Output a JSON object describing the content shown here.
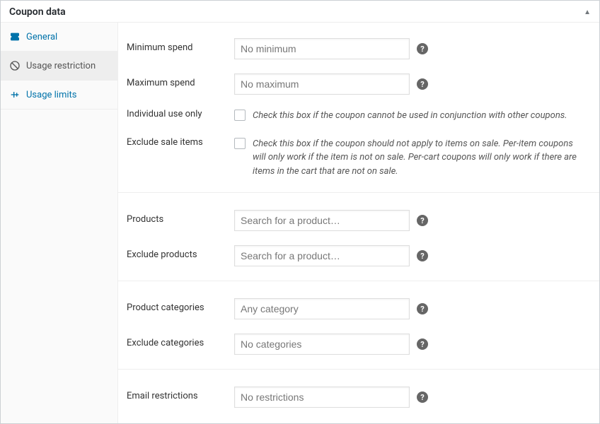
{
  "panel": {
    "title": "Coupon data"
  },
  "tabs": {
    "general": "General",
    "usage_restriction": "Usage restriction",
    "usage_limits": "Usage limits"
  },
  "fields": {
    "min_spend": {
      "label": "Minimum spend",
      "placeholder": "No minimum"
    },
    "max_spend": {
      "label": "Maximum spend",
      "placeholder": "No maximum"
    },
    "individual_use": {
      "label": "Individual use only",
      "desc": "Check this box if the coupon cannot be used in conjunction with other coupons."
    },
    "exclude_sale": {
      "label": "Exclude sale items",
      "desc": "Check this box if the coupon should not apply to items on sale. Per-item coupons will only work if the item is not on sale. Per-cart coupons will only work if there are items in the cart that are not on sale."
    },
    "products": {
      "label": "Products",
      "placeholder": "Search for a product…"
    },
    "exclude_products": {
      "label": "Exclude products",
      "placeholder": "Search for a product…"
    },
    "product_categories": {
      "label": "Product categories",
      "placeholder": "Any category"
    },
    "exclude_categories": {
      "label": "Exclude categories",
      "placeholder": "No categories"
    },
    "email_restrictions": {
      "label": "Email restrictions",
      "placeholder": "No restrictions"
    }
  }
}
